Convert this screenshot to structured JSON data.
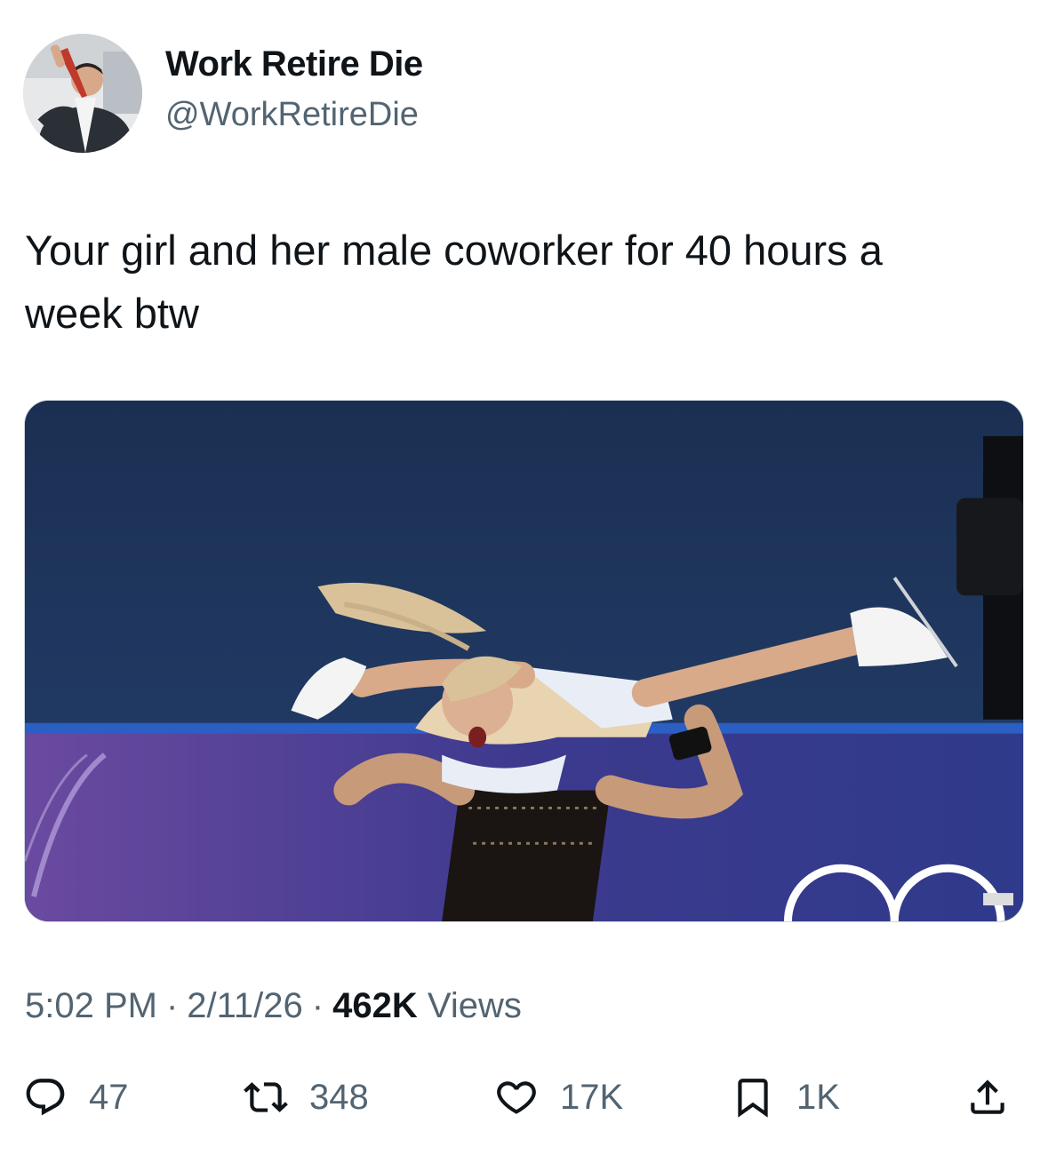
{
  "author": {
    "display_name": "Work Retire Die",
    "handle": "@WorkRetireDie",
    "avatar_icon": "avatar-photo"
  },
  "tweet": {
    "text_line1": "Your girl and her male coworker for 40 hours a",
    "text_line2": "week btw"
  },
  "media": {
    "description_icon": "figure-skating-photo",
    "colors": {
      "background": "#1d3557",
      "board": "#3b3a8a",
      "board_rail": "#2b4fb0"
    }
  },
  "meta": {
    "time": "5:02 PM",
    "date": "2/11/26",
    "views_count": "462K",
    "views_label": "Views",
    "separator": "·"
  },
  "actions": {
    "reply": {
      "icon": "reply-icon",
      "count": "47"
    },
    "retweet": {
      "icon": "retweet-icon",
      "count": "348"
    },
    "like": {
      "icon": "heart-icon",
      "count": "17K"
    },
    "bookmark": {
      "icon": "bookmark-icon",
      "count": "1K"
    },
    "share": {
      "icon": "share-icon"
    }
  },
  "colors": {
    "text_primary": "#0f1419",
    "text_secondary": "#536471",
    "border": "#cfd9de"
  }
}
